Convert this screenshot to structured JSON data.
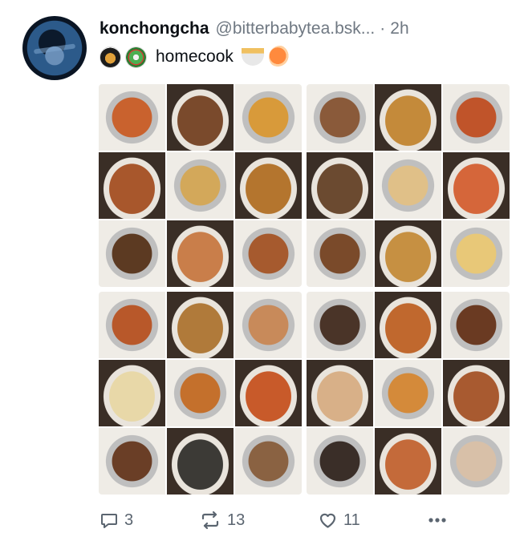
{
  "author": {
    "display_name": "konchongcha",
    "handle": "@bitterbabytea.bsk...",
    "separator": "·",
    "time": "2h"
  },
  "post": {
    "text": "homecook",
    "emoji_before": [
      "cooking-pot-emoji",
      "salad-emoji"
    ],
    "emoji_after": [
      "ramen-emoji",
      "fried-shrimp-emoji"
    ]
  },
  "images": [
    [
      "#c9622e",
      "#7a4a2c",
      "#d89a3a",
      "#a8572c",
      "#d3a85a",
      "#b4752e",
      "#5c3a22",
      "#c97e4a",
      "#a65a2e"
    ],
    [
      "#8a5a3a",
      "#c48a3a",
      "#c0542a",
      "#6b4a30",
      "#e0c088",
      "#d5663a",
      "#7a4a2a",
      "#c69042",
      "#e8c878"
    ],
    [
      "#b8582a",
      "#b07a3a",
      "#c88a5a",
      "#e8d8a8",
      "#c4702c",
      "#c85a2a",
      "#6a3e26",
      "#3c3a36",
      "#8a6242"
    ],
    [
      "#4a3428",
      "#c0682e",
      "#6a3a22",
      "#d8b088",
      "#d48a3a",
      "#a85a30",
      "#3a2e28",
      "#c46a3a",
      "#d8c0a8"
    ]
  ],
  "actions": {
    "replies": "3",
    "reposts": "13",
    "likes": "11"
  }
}
